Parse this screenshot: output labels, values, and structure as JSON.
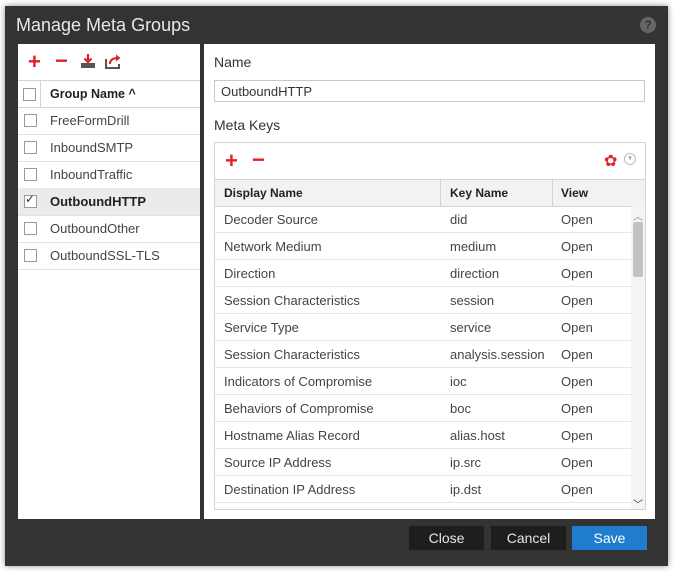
{
  "dialog": {
    "title": "Manage Meta Groups",
    "help_icon": "help-circle-icon"
  },
  "groups": {
    "toolbar": {
      "add_icon": "plus-icon",
      "remove_icon": "minus-icon",
      "import_icon": "import-icon",
      "export_icon": "export-icon"
    },
    "header": "Group Name ^",
    "items": [
      {
        "label": "FreeFormDrill",
        "checked": false,
        "selected": false
      },
      {
        "label": "InboundSMTP",
        "checked": false,
        "selected": false
      },
      {
        "label": "InboundTraffic",
        "checked": false,
        "selected": false
      },
      {
        "label": "OutboundHTTP",
        "checked": true,
        "selected": true
      },
      {
        "label": "OutboundOther",
        "checked": false,
        "selected": false
      },
      {
        "label": "OutboundSSL-TLS",
        "checked": false,
        "selected": false
      }
    ]
  },
  "detail": {
    "name_label": "Name",
    "name_value": "OutboundHTTP",
    "meta_keys_label": "Meta Keys",
    "toolbar": {
      "add_icon": "plus-icon",
      "remove_icon": "minus-icon",
      "settings_icon": "gear-icon",
      "dropdown_icon": "chevron-down-icon"
    },
    "columns": [
      "Display Name",
      "Key Name",
      "View"
    ],
    "rows": [
      [
        "Decoder Source",
        "did",
        "Open"
      ],
      [
        "Network Medium",
        "medium",
        "Open"
      ],
      [
        "Direction",
        "direction",
        "Open"
      ],
      [
        "Session Characteristics",
        "session",
        "Open"
      ],
      [
        "Service Type",
        "service",
        "Open"
      ],
      [
        "Session Characteristics",
        "analysis.session",
        "Open"
      ],
      [
        "Indicators of Compromise",
        "ioc",
        "Open"
      ],
      [
        "Behaviors of Compromise",
        "boc",
        "Open"
      ],
      [
        "Hostname Alias Record",
        "alias.host",
        "Open"
      ],
      [
        "Source IP Address",
        "ip.src",
        "Open"
      ],
      [
        "Destination IP Address",
        "ip.dst",
        "Open"
      ]
    ]
  },
  "footer": {
    "close_label": "Close",
    "cancel_label": "Cancel",
    "save_label": "Save"
  },
  "colors": {
    "accent_red": "#e21f26",
    "primary_blue": "#1f7ccf",
    "dialog_bg": "#333333"
  }
}
